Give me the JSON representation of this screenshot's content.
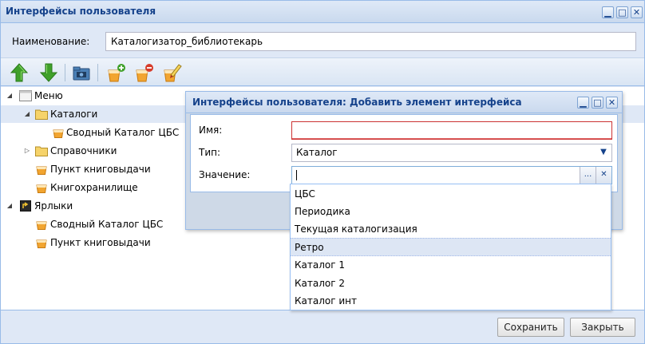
{
  "window": {
    "title": "Интерфейсы пользователя",
    "tools": {
      "minimize": "▁",
      "maximize": "□",
      "close": "✕"
    }
  },
  "form": {
    "name_label": "Наименование:",
    "name_value": "Каталогизатор_библиотекарь"
  },
  "toolbar": {
    "buttons": [
      "move-up",
      "move-down",
      "add-folder",
      "add-element",
      "delete-element",
      "edit-element"
    ]
  },
  "tree": {
    "items": [
      {
        "label": "Меню",
        "icon": "menu-icon",
        "expander": "◢"
      },
      {
        "label": "Каталоги",
        "icon": "folder-icon",
        "expander": "◢",
        "selected": true
      },
      {
        "label": "Сводный Каталог ЦБС",
        "icon": "element-icon"
      },
      {
        "label": "Справочники",
        "icon": "folder-icon",
        "expander": "▷"
      },
      {
        "label": "Пункт книговыдачи",
        "icon": "element-icon"
      },
      {
        "label": "Книгохранилище",
        "icon": "element-icon"
      },
      {
        "label": "Ярлыки",
        "icon": "shortcut-icon",
        "expander": "◢"
      },
      {
        "label": "Сводный Каталог ЦБС",
        "icon": "element-icon"
      },
      {
        "label": "Пункт книговыдачи",
        "icon": "element-icon"
      }
    ]
  },
  "footer": {
    "save_label": "Сохранить",
    "close_label": "Закрыть"
  },
  "dialog": {
    "title": "Интерфейсы пользователя: Добавить элемент интерфейса",
    "fields": {
      "name_label": "Имя:",
      "name_value": "",
      "type_label": "Тип:",
      "type_value": "Каталог",
      "value_label": "Значение:",
      "value_value": "",
      "ellipsis": "...",
      "clear": "✕",
      "chevron": "▼"
    }
  },
  "dropdown": {
    "options": [
      "ЦБС",
      "Периодика",
      "Текущая каталогизация",
      "Ретро",
      "Каталог 1",
      "Каталог 2",
      "Каталог инт"
    ],
    "highlighted": "Ретро"
  },
  "colors": {
    "title_text": "#15428b",
    "border": "#99bbe8",
    "panel_bg": "#dfe8f6",
    "invalid": "#cc3333"
  }
}
